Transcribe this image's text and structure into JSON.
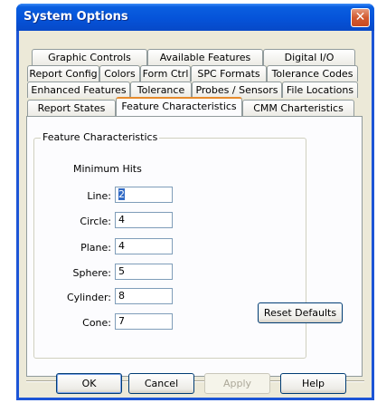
{
  "window": {
    "title": "System Options"
  },
  "tabs": {
    "row1": [
      "Graphic Controls",
      "Available Features",
      "Digital I/O"
    ],
    "row2": [
      "Report Config",
      "Colors",
      "Form Ctrl",
      "SPC Formats",
      "Tolerance Codes"
    ],
    "row3": [
      "Enhanced Features",
      "Tolerance",
      "Probes / Sensors",
      "File Locations"
    ],
    "row4": [
      "Report States",
      "Feature Characteristics",
      "CMM Charteristics"
    ],
    "active": "Feature Characteristics"
  },
  "group": {
    "title": "Feature Characteristics",
    "subtitle": "Minimum Hits",
    "fields": [
      {
        "label": "Line:",
        "value": "2"
      },
      {
        "label": "Circle:",
        "value": "4"
      },
      {
        "label": "Plane:",
        "value": "4"
      },
      {
        "label": "Sphere:",
        "value": "5"
      },
      {
        "label": "Cylinder:",
        "value": "8"
      },
      {
        "label": "Cone:",
        "value": "7"
      }
    ],
    "reset_label": "Reset Defaults"
  },
  "buttons": {
    "ok": "OK",
    "cancel": "Cancel",
    "apply": "Apply",
    "help": "Help"
  },
  "icons": {
    "close": "close-icon"
  }
}
